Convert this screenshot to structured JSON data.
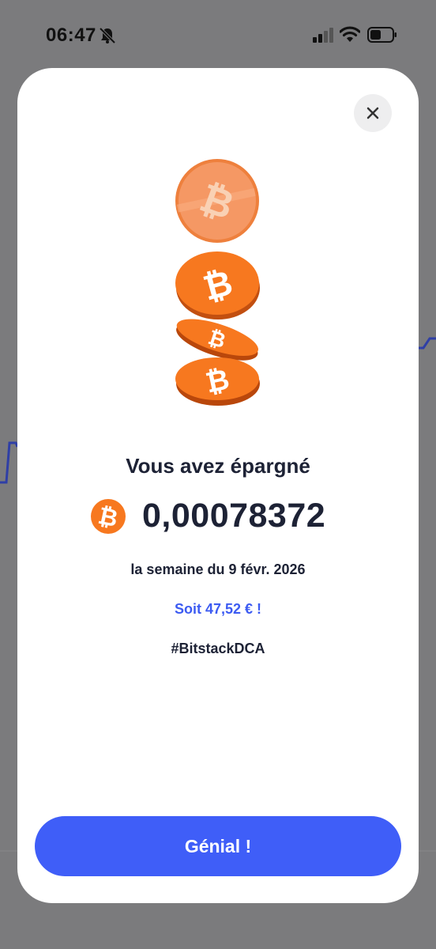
{
  "status_bar": {
    "time": "06:47",
    "icons": [
      "bell-slash-icon",
      "signal-icon",
      "wifi-icon",
      "battery-icon"
    ]
  },
  "modal": {
    "close_icon": "close-icon",
    "illustration": "bitcoin-coins-stack",
    "title": "Vous avez épargné",
    "amount": "0,00078372",
    "amount_icon": "bitcoin-icon",
    "period": "la semaine du 9 févr. 2026",
    "equivalent": "Soit 47,52 € !",
    "hashtag": "#BitstackDCA",
    "cta_label": "Génial !"
  },
  "colors": {
    "accent_blue": "#3f5ef8",
    "equivalent_text": "#3c5bf2",
    "bitcoin_orange": "#f7781f",
    "text_dark": "#1d2235",
    "overlay": "#7b7b7d"
  }
}
